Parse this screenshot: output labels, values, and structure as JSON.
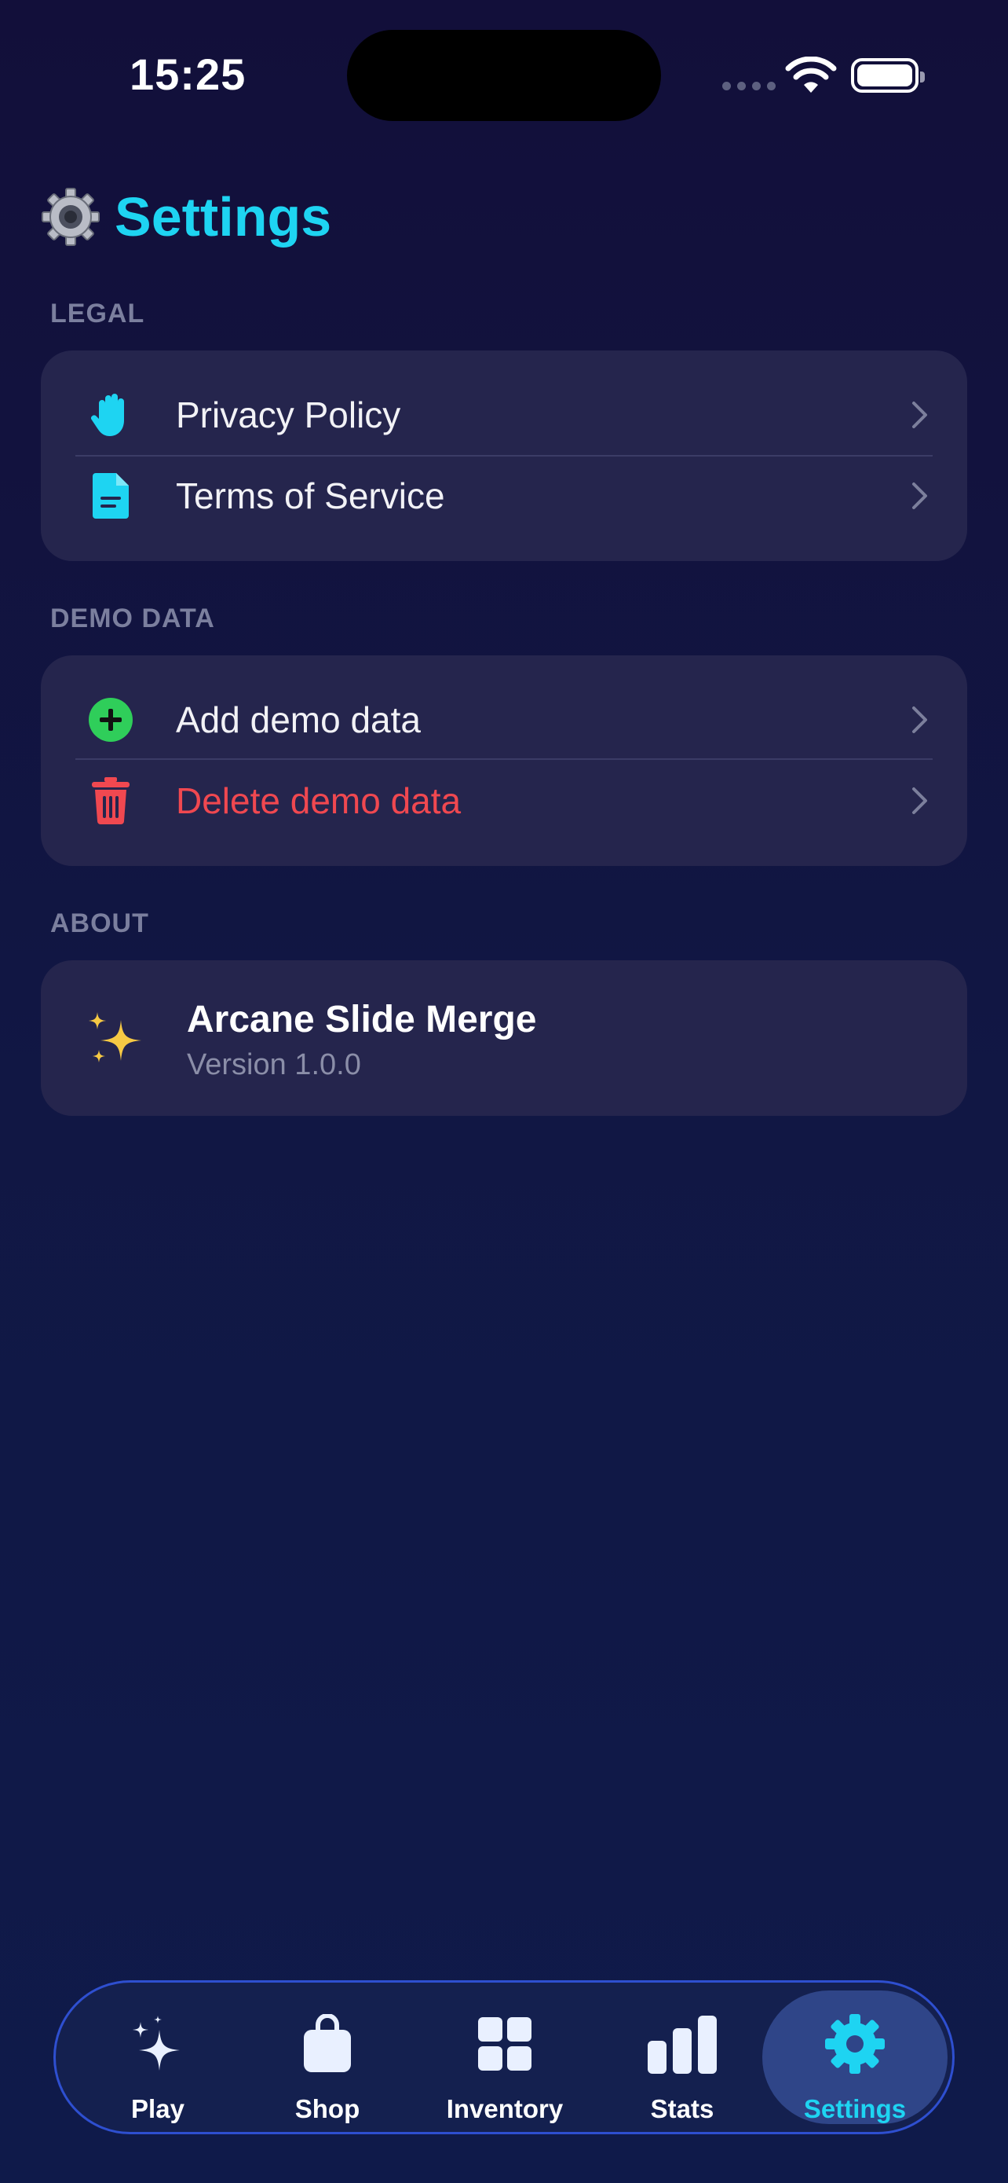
{
  "status": {
    "time": "15:25"
  },
  "header": {
    "title": "Settings",
    "icon": "gear-emoji"
  },
  "sections": {
    "legal": {
      "label": "LEGAL",
      "items": [
        {
          "label": "Privacy Policy",
          "icon": "hand-raised-icon"
        },
        {
          "label": "Terms of Service",
          "icon": "document-icon"
        }
      ]
    },
    "demo": {
      "label": "DEMO DATA",
      "items": [
        {
          "label": "Add demo data",
          "icon": "plus-circle-icon"
        },
        {
          "label": "Delete demo data",
          "icon": "trash-icon"
        }
      ]
    },
    "about": {
      "label": "ABOUT",
      "app_name": "Arcane Slide Merge",
      "version": "Version 1.0.0"
    }
  },
  "tabs": [
    {
      "label": "Play",
      "icon": "sparkles-icon"
    },
    {
      "label": "Shop",
      "icon": "bag-icon"
    },
    {
      "label": "Inventory",
      "icon": "grid-icon"
    },
    {
      "label": "Stats",
      "icon": "bar-chart-icon"
    },
    {
      "label": "Settings",
      "icon": "gear-icon",
      "active": true
    }
  ],
  "colors": {
    "accent": "#1ed4f2",
    "danger": "#f04850",
    "success": "#2fce5a",
    "card": "#25254d"
  }
}
